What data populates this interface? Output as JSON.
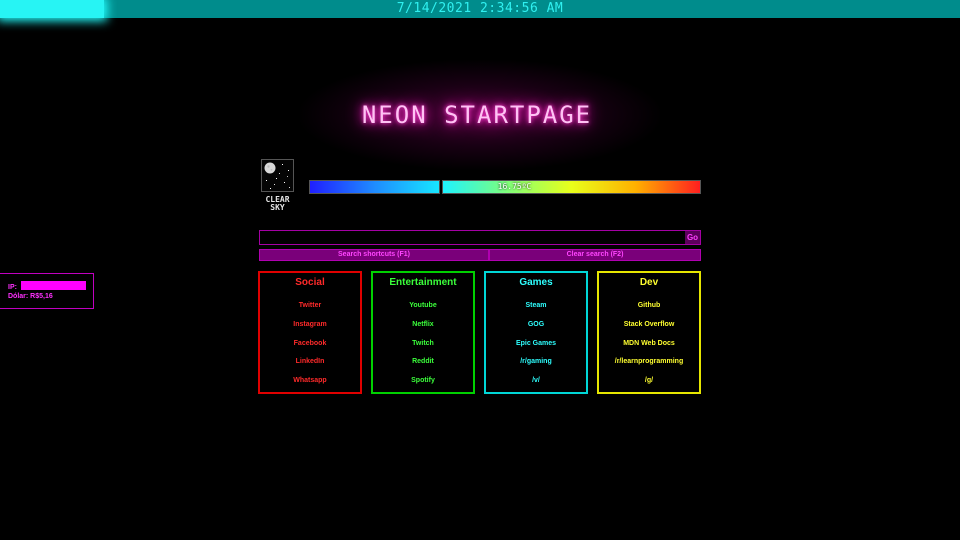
{
  "clock": "7/14/2021 2:34:56 AM",
  "title": "NEON STARTPAGE",
  "weather": {
    "condition_label": "CLEAR SKY",
    "temperature": "16.75ºC",
    "icon": "moon-night-icon"
  },
  "search": {
    "value": "",
    "go_label": "Go",
    "shortcuts_label": "Search shortcuts (F1)",
    "clear_label": "Clear search (F2)"
  },
  "info": {
    "ip_label": "IP:",
    "dollar_label": "Dólar: R$5,16"
  },
  "categories": [
    {
      "title": "Social",
      "links": [
        "Twitter",
        "Instagram",
        "Facebook",
        "LinkedIn",
        "Whatsapp"
      ]
    },
    {
      "title": "Entertainment",
      "links": [
        "Youtube",
        "Netflix",
        "Twitch",
        "Reddit",
        "Spotify"
      ]
    },
    {
      "title": "Games",
      "links": [
        "Steam",
        "GOG",
        "Epic Games",
        "/r/gaming",
        "/v/"
      ]
    },
    {
      "title": "Dev",
      "links": [
        "Github",
        "Stack Overflow",
        "MDN Web Docs",
        "/r/learnprogramming",
        "/g/"
      ]
    }
  ],
  "colors": {
    "social": "#ff2020",
    "entertainment": "#20ff20",
    "games": "#20ffff",
    "dev": "#ffff20",
    "accent": "#ff00ff",
    "topbar": "#008c8c"
  }
}
